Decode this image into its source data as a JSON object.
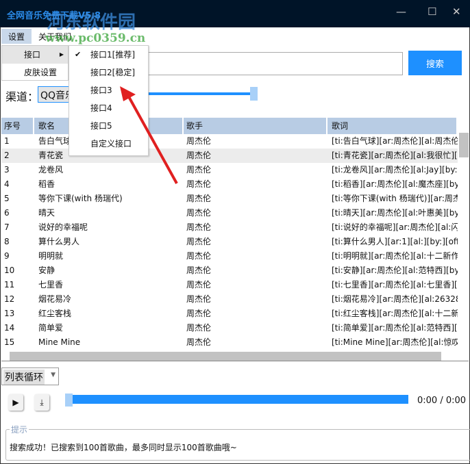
{
  "app": {
    "title": "全网音乐免费下载V5.8",
    "watermark_cn": "河东软件园",
    "watermark_url": "www.pc0359.cn"
  },
  "window_controls": {
    "minimize": "—",
    "maximize": "☐",
    "close": "✕"
  },
  "menubar": [
    "设置",
    "关于我们"
  ],
  "settings_menu": [
    {
      "label": "接口",
      "submenu": true
    },
    {
      "label": "皮肤设置"
    }
  ],
  "interface_submenu": [
    {
      "label": "接口1[推荐]",
      "checked": true
    },
    {
      "label": "接口2[稳定]"
    },
    {
      "label": "接口3"
    },
    {
      "label": "接口4"
    },
    {
      "label": "接口5"
    },
    {
      "label": "自定义接口"
    }
  ],
  "search": {
    "value": "",
    "button": "搜索"
  },
  "channel": {
    "label": "渠道：",
    "value": "QQ音乐"
  },
  "table": {
    "headers": [
      "序号",
      "歌名",
      "歌手",
      "歌词"
    ],
    "rows": [
      [
        "1",
        "告白气球",
        "周杰伦",
        "[ti:告白气球][ar:周杰伦][al:周杰伦..."
      ],
      [
        "2",
        "青花瓷",
        "周杰伦",
        "[ti:青花瓷][ar:周杰伦][al:我很忙][..."
      ],
      [
        "3",
        "龙卷风",
        "周杰伦",
        "[ti:龙卷风][ar:周杰伦][al:Jay][by:]..."
      ],
      [
        "4",
        "稻香",
        "周杰伦",
        "[ti:稻香][ar:周杰伦][al:魔杰座][by:..."
      ],
      [
        "5",
        "等你下课(with 杨瑞代)",
        "周杰伦",
        "[ti:等你下课(with 杨瑞代)][ar:周杰..."
      ],
      [
        "6",
        "晴天",
        "周杰伦",
        "[ti:晴天][ar:周杰伦][al:叶惠美][by:..."
      ],
      [
        "7",
        "说好的幸福呢",
        "周杰伦",
        "[ti:说好的幸福呢][ar:周杰伦][al:闪..."
      ],
      [
        "8",
        "算什么男人",
        "周杰伦",
        "[ti:算什么男人][ar:1][al:][by:][offs..."
      ],
      [
        "9",
        "明明就",
        "周杰伦",
        "[ti:明明就][ar:周杰伦][al:十二新作..."
      ],
      [
        "10",
        "安静",
        "周杰伦",
        "[ti:安静][ar:周杰伦][al:范特西][by:..."
      ],
      [
        "11",
        "七里香",
        "周杰伦",
        "[ti:七里香][ar:周杰伦][al:七里香][..."
      ],
      [
        "12",
        "烟花易冷",
        "周杰伦",
        "[ti:烟花易冷][ar:周杰伦][al:26328..."
      ],
      [
        "13",
        "红尘客栈",
        "周杰伦",
        "[ti:红尘客栈][ar:周杰伦][al:十二新..."
      ],
      [
        "14",
        "简单爱",
        "周杰伦",
        "[ti:简单爱][ar:周杰伦][al:范特西][..."
      ],
      [
        "15",
        "Mine Mine",
        "周杰伦",
        "[ti:Mine Mine][ar:周杰伦][al:惊叹..."
      ]
    ]
  },
  "player": {
    "mode": "列表循环",
    "time": "0:00 / 0:00",
    "progress": 0
  },
  "tip": {
    "label": "提示",
    "message": "搜索成功！已搜索到100首歌曲，最多同时显示100首歌曲哦~"
  }
}
